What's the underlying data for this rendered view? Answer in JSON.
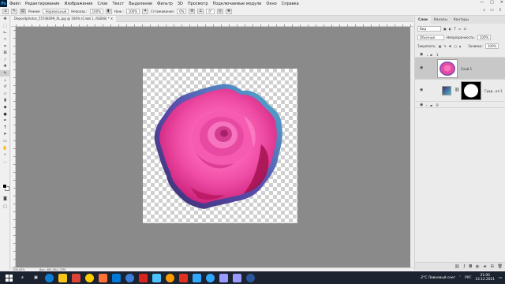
{
  "menubar": {
    "logo": "Ps",
    "items": [
      "Файл",
      "Редактирование",
      "Изображение",
      "Слои",
      "Текст",
      "Выделение",
      "Фильтр",
      "3D",
      "Просмотр",
      "Подключаемые модули",
      "Окно",
      "Справка"
    ],
    "controls": [
      "—",
      "□",
      "✕"
    ]
  },
  "options": {
    "mode_label": "Режим:",
    "mode_value": "Нормальный",
    "opacity_label": "Непрозр.:",
    "opacity_value": "100%",
    "pressure_label": "Наж.:",
    "pressure_value": "100%",
    "smoothing_label": "Сглаживание:",
    "smoothing_value": "0%",
    "angle_value": "0°"
  },
  "document": {
    "tab_title": "Depositphotos_55748399_XL.jpg @ 106% (Слой 1, RGB/8) *  ✕",
    "status_zoom": "106,45%",
    "status_doc": "Док: 462,0K/1,23M"
  },
  "panel": {
    "tabs": [
      "Слои",
      "Каналы",
      "Контуры"
    ],
    "filter_label": "Вид",
    "blend_mode": "Обычные",
    "opacity_label": "Непрозрачность:",
    "opacity_value": "100%",
    "lock_label": "Закрепить:",
    "fill_label": "Заливка:",
    "fill_value": "100%",
    "layers": [
      {
        "name": "1",
        "type": "group"
      },
      {
        "name": "Слой 1",
        "type": "pixel"
      },
      {
        "name": "Град...ая 1",
        "type": "adjustment"
      },
      {
        "name": "0",
        "type": "group"
      }
    ],
    "bottom_icons": [
      "link-icon",
      "fx-icon",
      "mask-icon",
      "adjustment-icon",
      "folder-icon",
      "new-layer-icon",
      "trash-icon"
    ]
  },
  "taskbar": {
    "icons": [
      {
        "name": "windows-start-icon",
        "color": "#ffffff"
      },
      {
        "name": "search-icon",
        "color": "#ffffff"
      },
      {
        "name": "task-view-icon",
        "color": "#ffffff"
      },
      {
        "name": "edge-icon",
        "color": "#0f7fd6"
      },
      {
        "name": "explorer-icon",
        "color": "#f5c518"
      },
      {
        "name": "chrome-icon",
        "color": "#db4437"
      },
      {
        "name": "yandex-icon",
        "color": "#ffcc00"
      },
      {
        "name": "firefox-icon",
        "color": "#ff7139"
      },
      {
        "name": "store-icon",
        "color": "#0078d7"
      },
      {
        "name": "mail-icon",
        "color": "#3b7dd8"
      },
      {
        "name": "acrobat-icon",
        "color": "#d9241c"
      },
      {
        "name": "photos-icon",
        "color": "#4cc2ff"
      },
      {
        "name": "illustrator-icon",
        "color": "#ff9a00"
      },
      {
        "name": "media-icon",
        "color": "#e0311e"
      },
      {
        "name": "photoshop-icon",
        "color": "#31a8ff"
      },
      {
        "name": "lightroom-icon",
        "color": "#31a8ff"
      },
      {
        "name": "premiere-icon",
        "color": "#9999ff"
      },
      {
        "name": "after-effects-icon",
        "color": "#9999ff"
      },
      {
        "name": "word-icon",
        "color": "#2b579a"
      }
    ],
    "weather": "-2°C  Ливневый снег",
    "lang": "РУС",
    "time": "21:00",
    "date": "13.12.2021"
  },
  "colors": {
    "rose": "#e63e9e",
    "rose_dark": "#8e1048",
    "outline_gradient_start": "#3a2d6e",
    "outline_gradient_end": "#4db7d0"
  }
}
